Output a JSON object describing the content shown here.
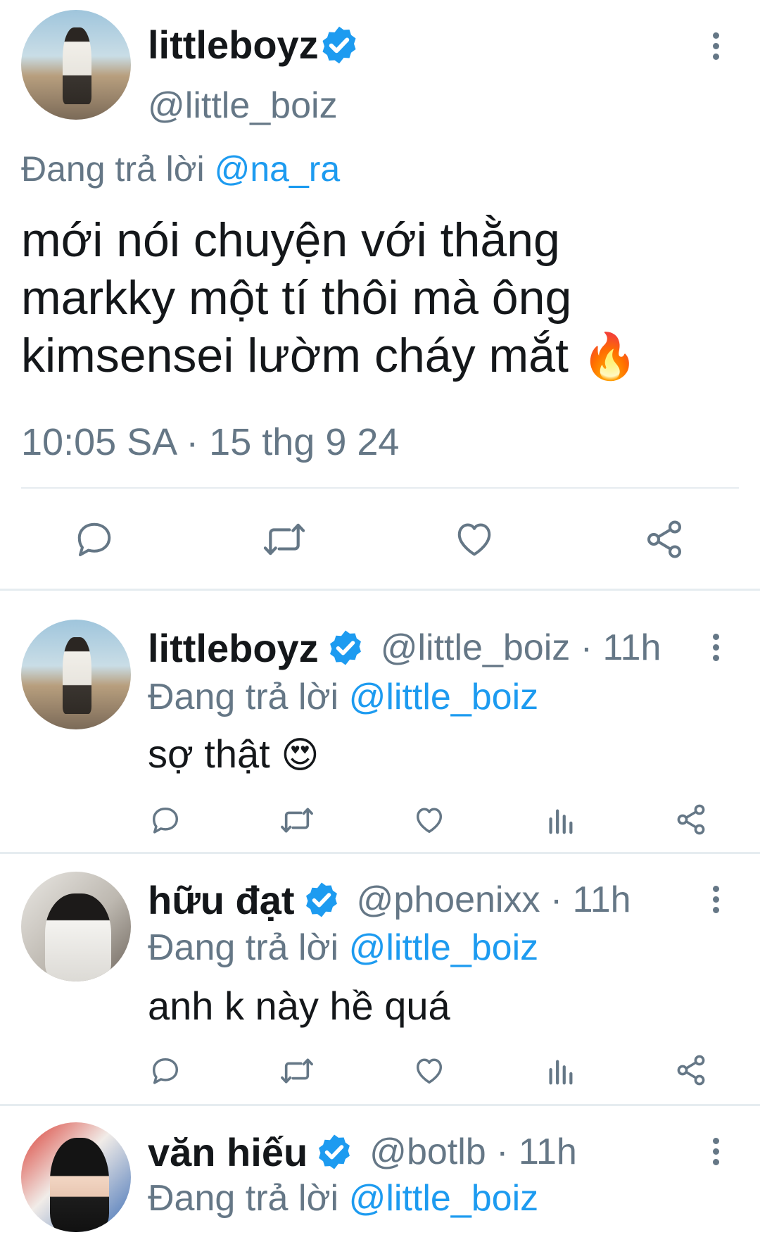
{
  "main_tweet": {
    "display_name": "littleboyz",
    "handle": "@little_boiz",
    "reply_prefix": "Đang trả lời",
    "reply_mention": "@na_ra",
    "text_line1": "mới nói chuyện với thằng",
    "text_line2": "markky một tí thôi mà ông",
    "text_line3": "kimsensei lườm cháy mắt",
    "emoji": "🔥",
    "timestamp": "10:05 SA · 15 thg 9 24"
  },
  "replies": [
    {
      "display_name": "littleboyz",
      "handle": "@little_boiz · 11h",
      "reply_prefix": "Đang trả lời",
      "reply_mention": "@little_boiz",
      "text": "sợ thật",
      "emoji": "😍"
    },
    {
      "display_name": "hữu đạt",
      "handle": "@phoenixx · 11h",
      "reply_prefix": "Đang trả lời",
      "reply_mention": "@little_boiz",
      "text": "anh k này hề quá"
    },
    {
      "display_name": "văn hiếu",
      "handle": "@botlb · 11h",
      "reply_prefix": "Đang trả lời",
      "reply_mention": "@little_boiz"
    }
  ],
  "colors": {
    "accent": "#1d9bf0",
    "secondary_text": "#657786",
    "primary_text": "#14171a",
    "divider": "#e6ecf0"
  },
  "icons": [
    "verified-badge-icon",
    "more-options-icon",
    "reply-icon",
    "retweet-icon",
    "like-icon",
    "views-icon",
    "share-icon"
  ]
}
